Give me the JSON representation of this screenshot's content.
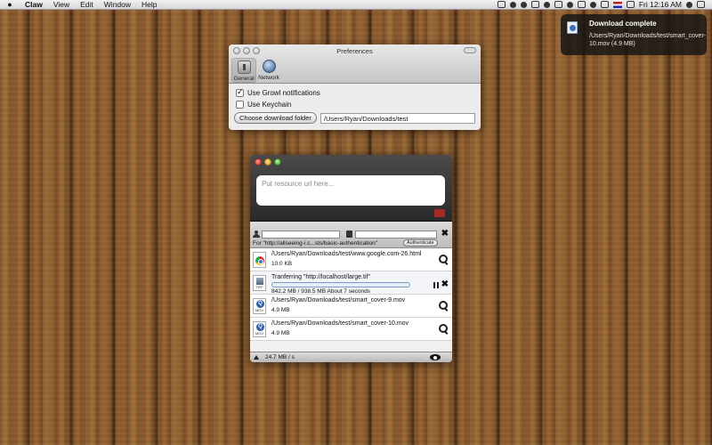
{
  "menubar": {
    "app_name": "Claw",
    "menus": [
      "View",
      "Edit",
      "Window",
      "Help"
    ],
    "clock": "Fri 12:16 AM"
  },
  "notification": {
    "title": "Download complete",
    "text": "/Users/Ryan/Downloads/test/smart_cover-10.mov (4.9 MB)"
  },
  "preferences": {
    "title": "Preferences",
    "toolbar": [
      {
        "label": "General",
        "icon": "general-icon",
        "active": true
      },
      {
        "label": "Network",
        "icon": "network-icon",
        "active": false
      }
    ],
    "growl_label": "Use Growl notifications",
    "growl_checked": true,
    "keychain_label": "Use Keychain",
    "keychain_checked": false,
    "choose_folder_label": "Choose download folder",
    "download_folder": "/Users/Ryan/Downloads/test"
  },
  "claw": {
    "url_placeholder": "Put resource url here...",
    "auth": {
      "for_text": "For \"http://allseeing-i.c...sts/basic-authentication\"",
      "authenticate_label": "Authenticate"
    },
    "downloads": [
      {
        "path": "/Users/Ryan/Downloads/test/www.google.com-26.html",
        "size": "10.0 KB",
        "icon": "chrome-file-icon"
      },
      {
        "path": "Tranferring  \"http://localhost/large.tif\"",
        "status": "842.2 MB / 938.5 MB  About 7 seconds",
        "progress": 0.897,
        "icon": "tiff-file-icon"
      },
      {
        "path": "/Users/Ryan/Downloads/test/smart_cover-9.mov",
        "size": "4.9 MB",
        "icon": "mov-file-icon"
      },
      {
        "path": "/Users/Ryan/Downloads/test/smart_cover-10.mov",
        "size": "4.9 MB",
        "icon": "mov-file-icon"
      }
    ],
    "speed": "24.7 MB / s"
  }
}
